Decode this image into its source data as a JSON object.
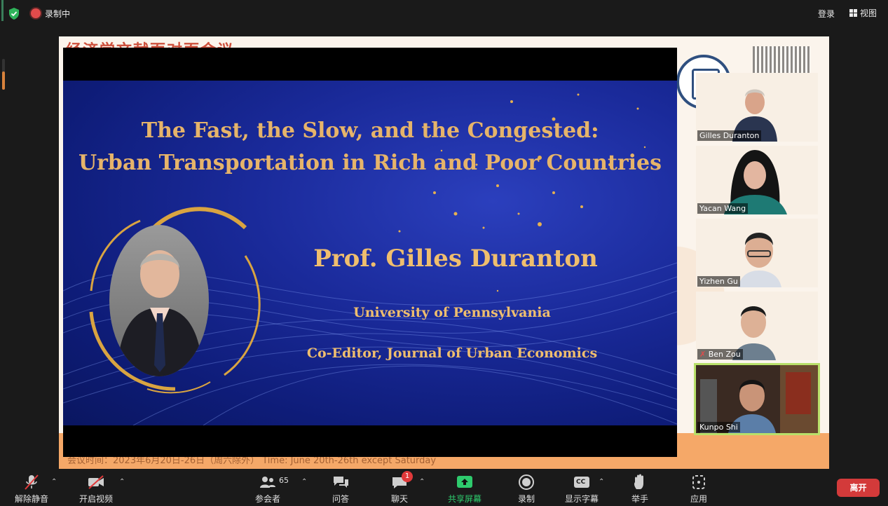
{
  "topbar": {
    "recording_label": "录制中",
    "login_label": "登录",
    "view_label": "视图"
  },
  "share": {
    "background_title": "经济学文献面对面会议",
    "background_footer": "会议时间：2023年6月20日-26日（周六除外） Time: June 20th-26th except Saturday"
  },
  "slide": {
    "title_line1": "The Fast, the Slow, and the Congested:",
    "title_line2": "Urban Transportation in Rich and Poor Countries",
    "speaker": "Prof. Gilles Duranton",
    "affiliation": "University of Pennsylvania",
    "role": "Co-Editor, Journal of Urban Economics"
  },
  "participants": [
    {
      "name": "Gilles Duranton",
      "muted": false
    },
    {
      "name": "Yacan Wang",
      "muted": false
    },
    {
      "name": "Yizhen Gu",
      "muted": false
    },
    {
      "name": "Ben Zou",
      "muted": true
    },
    {
      "name": "Kunpo Shi",
      "muted": false,
      "active": true
    }
  ],
  "toolbar": {
    "unmute": "解除静音",
    "start_video": "开启视频",
    "participants": "参会者",
    "participants_count": "65",
    "qa": "问答",
    "chat": "聊天",
    "chat_badge": "1",
    "share_screen": "共享屏幕",
    "record": "录制",
    "captions": "显示字幕",
    "captions_icon_text": "CC",
    "raise_hand": "举手",
    "apps": "应用",
    "leave": "离开"
  },
  "colors": {
    "accent_green": "#2ecb6d",
    "leave_red": "#d33a3a",
    "slide_gold": "#efbe6e",
    "slide_blue": "#1a2a9a"
  }
}
